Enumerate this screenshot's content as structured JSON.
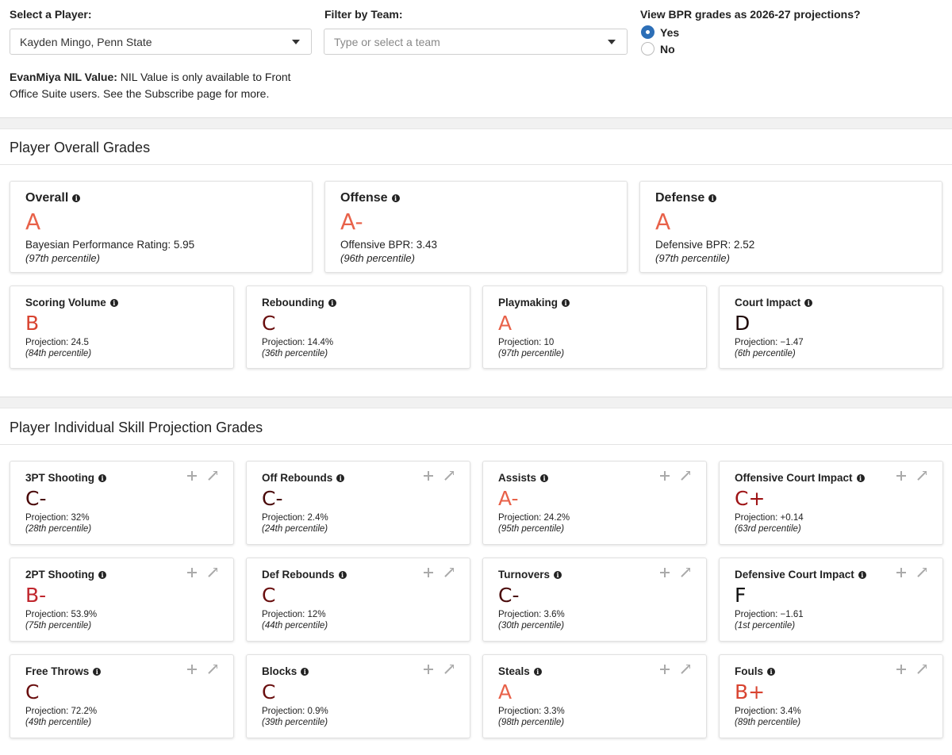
{
  "filters": {
    "player_label": "Select a Player:",
    "player_value": "Kayden Mingo, Penn State",
    "team_label": "Filter by Team:",
    "team_placeholder": "Type or select a team",
    "projection_label": "View BPR grades as 2026-27 projections?",
    "options": [
      {
        "label": "Yes",
        "selected": true
      },
      {
        "label": "No",
        "selected": false
      }
    ]
  },
  "nil": {
    "bold": "EvanMiya NIL Value:",
    "text": " NIL Value is only available to Front Office Suite users. See the Subscribe page for more."
  },
  "colors": {
    "A": "#e8624a",
    "A-": "#e8624a",
    "B+": "#d84330",
    "B": "#d84330",
    "B-": "#c0262d",
    "C+": "#9e1416",
    "C": "#6a0f0f",
    "C-": "#4a0a0a",
    "D": "#1e0808",
    "F": "#111111"
  },
  "overall_section": {
    "title": "Player Overall Grades",
    "top_cards": [
      {
        "title": "Overall",
        "grade": "A",
        "line1": "Bayesian Performance Rating: 5.95",
        "line2": "(97th percentile)"
      },
      {
        "title": "Offense",
        "grade": "A-",
        "line1": "Offensive BPR: 3.43",
        "line2": "(96th percentile)"
      },
      {
        "title": "Defense",
        "grade": "A",
        "line1": "Defensive BPR: 2.52",
        "line2": "(97th percentile)"
      }
    ],
    "sub_cards": [
      {
        "title": "Scoring Volume",
        "grade": "B",
        "line1": "Projection: 24.5",
        "line2": "(84th percentile)"
      },
      {
        "title": "Rebounding",
        "grade": "C",
        "line1": "Projection: 14.4%",
        "line2": "(36th percentile)"
      },
      {
        "title": "Playmaking",
        "grade": "A",
        "line1": "Projection: 10",
        "line2": "(97th percentile)"
      },
      {
        "title": "Court Impact",
        "grade": "D",
        "line1": "Projection: −1.47",
        "line2": "(6th percentile)"
      }
    ]
  },
  "skill_section": {
    "title": "Player Individual Skill Projection Grades",
    "cards": [
      {
        "title": "3PT Shooting",
        "grade": "C-",
        "line1": "Projection: 32%",
        "line2": "(28th percentile)"
      },
      {
        "title": "Off Rebounds",
        "grade": "C-",
        "line1": "Projection: 2.4%",
        "line2": "(24th percentile)"
      },
      {
        "title": "Assists",
        "grade": "A-",
        "line1": "Projection: 24.2%",
        "line2": "(95th percentile)"
      },
      {
        "title": "Offensive Court Impact",
        "grade": "C+",
        "line1": "Projection: +0.14",
        "line2": "(63rd percentile)"
      },
      {
        "title": "2PT Shooting",
        "grade": "B-",
        "line1": "Projection: 53.9%",
        "line2": "(75th percentile)"
      },
      {
        "title": "Def Rebounds",
        "grade": "C",
        "line1": "Projection: 12%",
        "line2": "(44th percentile)"
      },
      {
        "title": "Turnovers",
        "grade": "C-",
        "line1": "Projection: 3.6%",
        "line2": "(30th percentile)"
      },
      {
        "title": "Defensive Court Impact",
        "grade": "F",
        "line1": "Projection: −1.61",
        "line2": "(1st percentile)"
      },
      {
        "title": "Free Throws",
        "grade": "C",
        "line1": "Projection: 72.2%",
        "line2": "(49th percentile)"
      },
      {
        "title": "Blocks",
        "grade": "C",
        "line1": "Projection: 0.9%",
        "line2": "(39th percentile)"
      },
      {
        "title": "Steals",
        "grade": "A",
        "line1": "Projection: 3.3%",
        "line2": "(98th percentile)"
      },
      {
        "title": "Fouls",
        "grade": "B+",
        "line1": "Projection: 3.4%",
        "line2": "(89th percentile)"
      }
    ]
  }
}
